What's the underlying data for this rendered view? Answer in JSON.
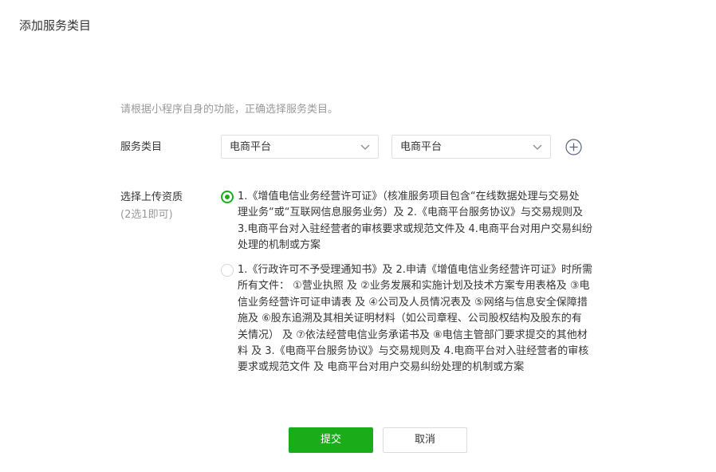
{
  "dialog": {
    "title": "添加服务类目"
  },
  "hint": "请根据小程序自身的功能，正确选择服务类目。",
  "category": {
    "label": "服务类目",
    "primary_select": "电商平台",
    "secondary_select": "电商平台",
    "add_icon": "plus-circle-icon"
  },
  "qualification": {
    "label": "选择上传资质",
    "sub_label": "(2选1即可)",
    "options": [
      {
        "checked": true,
        "text": "1.《增值电信业务经营许可证》（核准服务项目包含“在线数据处理与交易处\n理业务“或“互联网信息服务业务）及 2.《电商平台服务协议》与交易规则及\n3.电商平台对入驻经营者的审核要求或规范文件及 4.电商平台对用户交易纠纷\n处理的机制或方案"
      },
      {
        "checked": false,
        "text": "1.《行政许可不予受理通知书》及 2.申请《增值电信业务经营许可证》时所需\n所有文件： ①营业执照 及 ②业务发展和实施计划及技术方案专用表格及 ③电\n信业务经营许可证申请表 及 ④公司及人员情况表及 ⑤网络与信息安全保障措\n施及 ⑥股东追溯及其相关证明材料（如公司章程、公司股权结构及股东的有\n关情况） 及 ⑦依法经营电信业务承诺书及 ⑧电信主管部门要求提交的其他材\n料 及 3.《电商平台服务协议》与交易规则及 4.电商平台对入驻经营者的审核\n要求或规范文件 及 电商平台对用户交易纠纷处理的机制或方案"
      }
    ]
  },
  "actions": {
    "submit": "提交",
    "cancel": "取消"
  },
  "colors": {
    "accent": "#1aad19",
    "hint_text": "#9a9a9a",
    "body_text": "#353535",
    "border": "#e0e0e0"
  }
}
